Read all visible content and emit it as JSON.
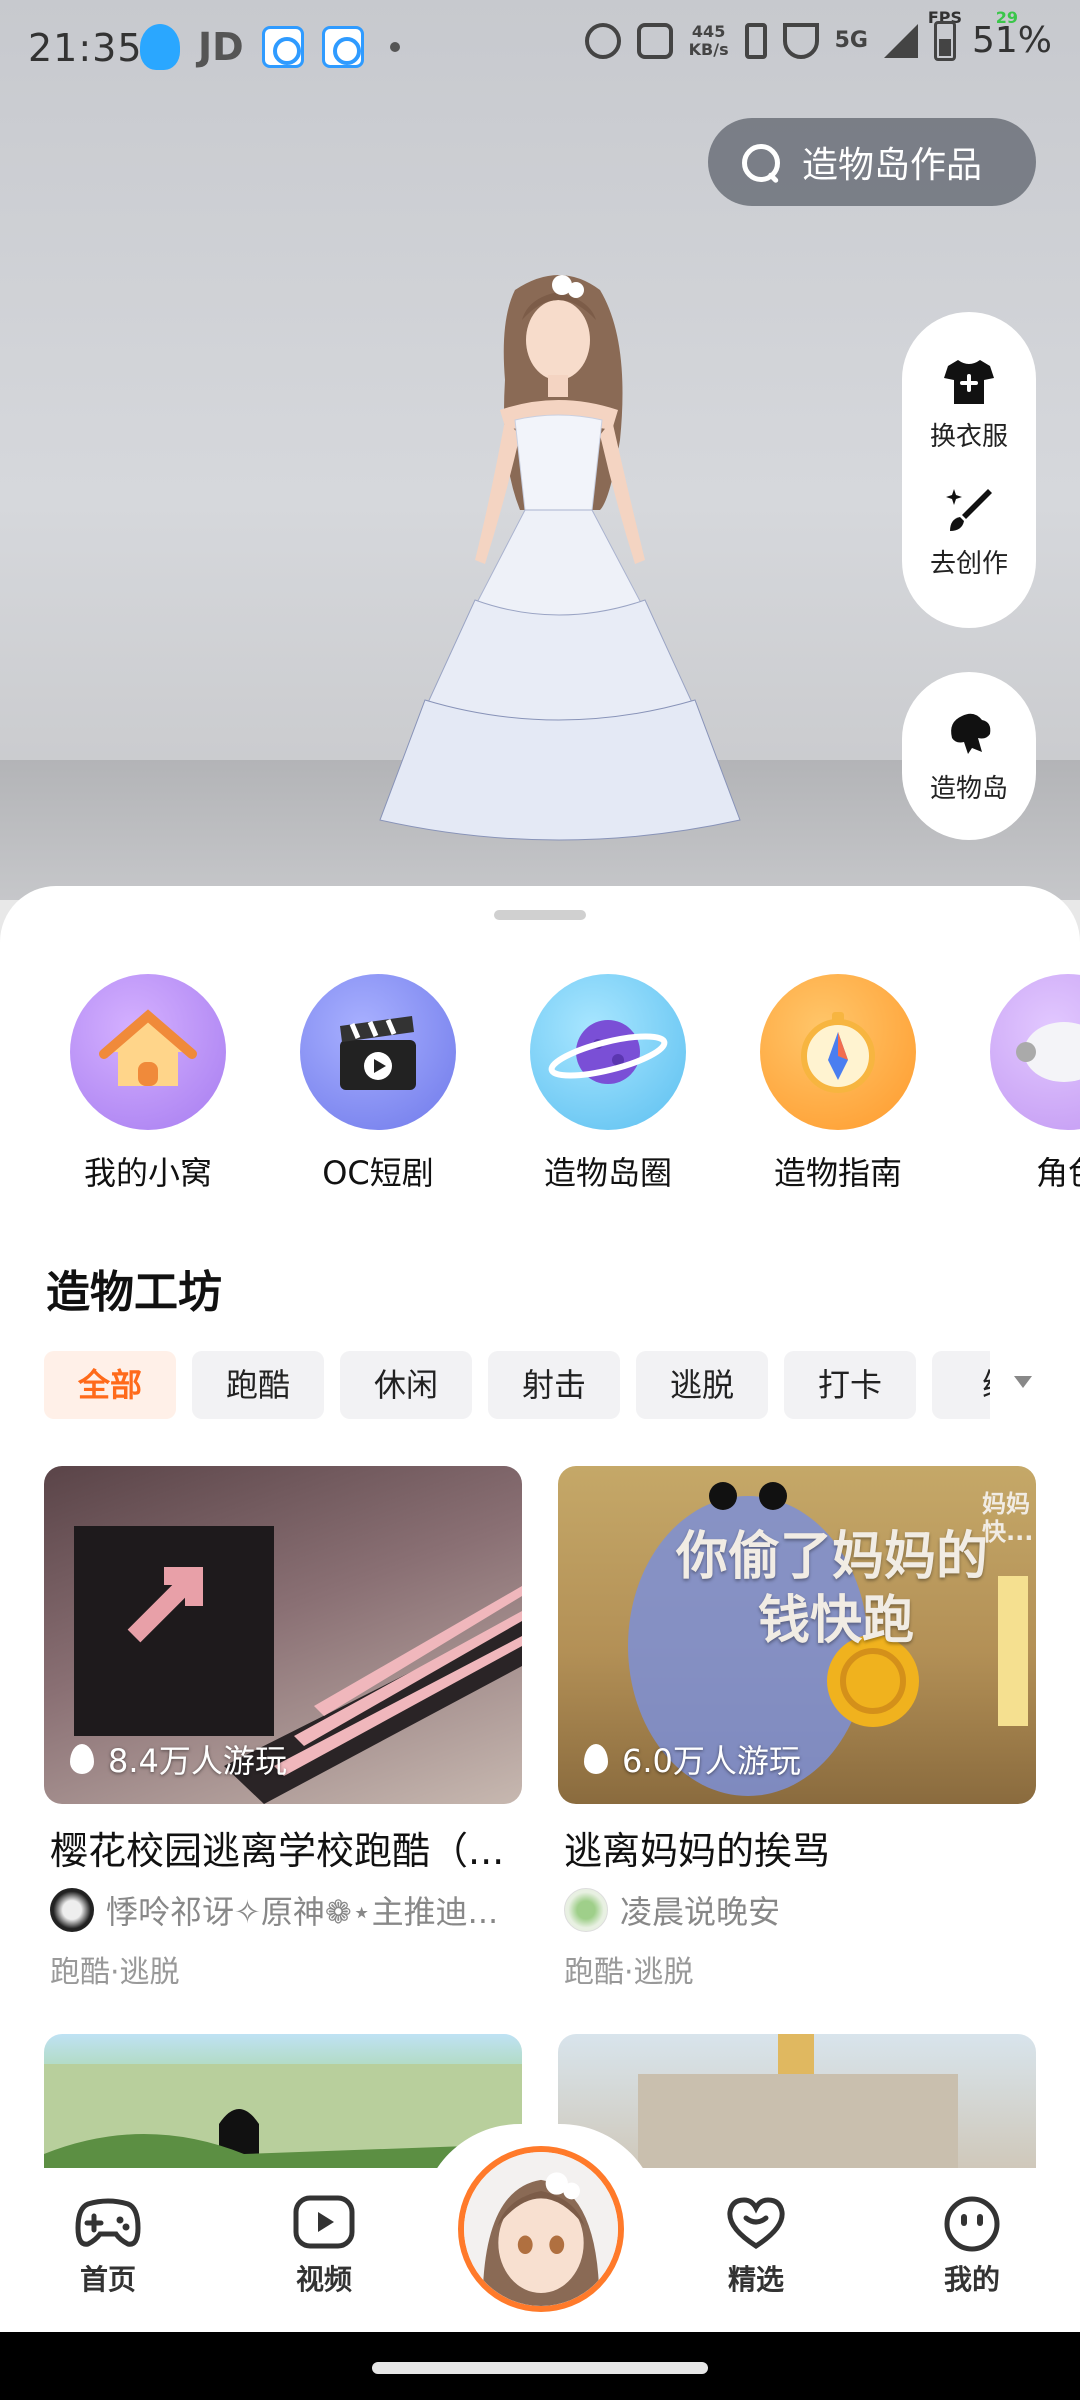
{
  "status_bar": {
    "time": "21:35",
    "jd": "JD",
    "speed": "445\nKB/s",
    "network": "5G",
    "fps_label": "FPS",
    "fps_value": "29",
    "battery": "51%"
  },
  "search": {
    "placeholder": "造物岛作品"
  },
  "side_actions": {
    "change_clothes": "换衣服",
    "create": "去创作",
    "island": "造物岛"
  },
  "shortcuts": [
    {
      "label": "我的小窝",
      "color": "#b889f5"
    },
    {
      "label": "OC短剧",
      "color": "#7c86f0"
    },
    {
      "label": "造物岛圈",
      "color": "#69c8f4"
    },
    {
      "label": "造物指南",
      "color": "#ffa640"
    },
    {
      "label": "角色",
      "color": "#c99af5"
    }
  ],
  "section": {
    "title": "造物工坊"
  },
  "chips": [
    "全部",
    "跑酷",
    "休闲",
    "射击",
    "逃脱",
    "打卡",
    "练"
  ],
  "cards": [
    {
      "plays": "8.4万人游玩",
      "title": "樱花校园逃离学校跑酷（...",
      "author": "悸呤祁讶✧原神❁⋆主推迪...",
      "tags": "跑酷·逃脱"
    },
    {
      "plays": "6.0万人游玩",
      "title": "逃离妈妈的挨骂",
      "author": "凌晨说晚安",
      "tags": "跑酷·逃脱",
      "image_text_1": "你偷了妈妈的",
      "image_text_2": "钱快跑",
      "image_corner": "妈妈\n快..."
    }
  ],
  "nav": {
    "home": "首页",
    "video": "视频",
    "featured": "精选",
    "mine": "我的"
  },
  "colors": {
    "accent": "#ff6a1a",
    "chip_active_bg": "#fff0e8"
  }
}
